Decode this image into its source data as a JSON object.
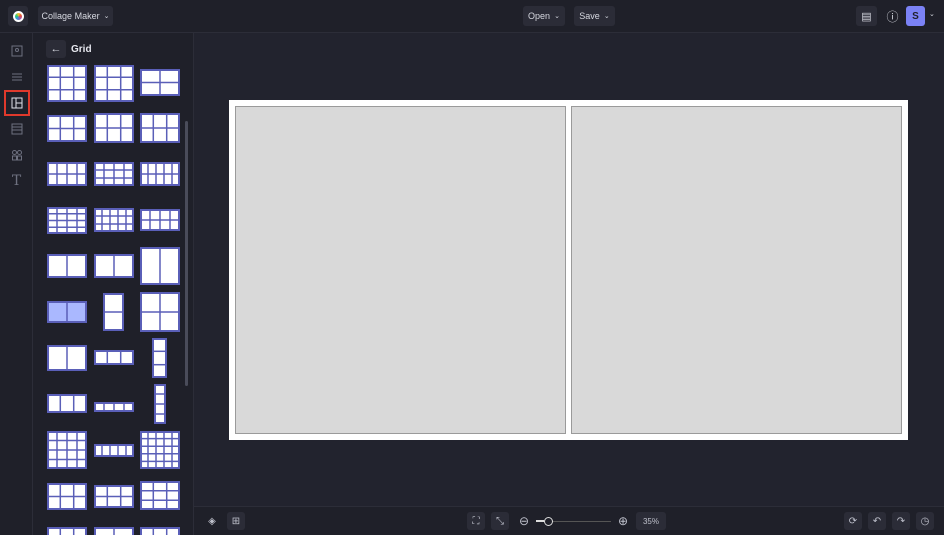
{
  "header": {
    "app_menu": "Collage Maker",
    "open": "Open",
    "save": "Save",
    "avatar_initial": "S"
  },
  "panel": {
    "title": "Grid"
  },
  "zoom": {
    "level": "35%",
    "slider_fraction": 0.1
  },
  "colors": {
    "accent": "#7b82f5",
    "active_outline": "#e0392c",
    "thumb_border": "#5a5fb8",
    "selected_thumb": "#aab8ff"
  }
}
